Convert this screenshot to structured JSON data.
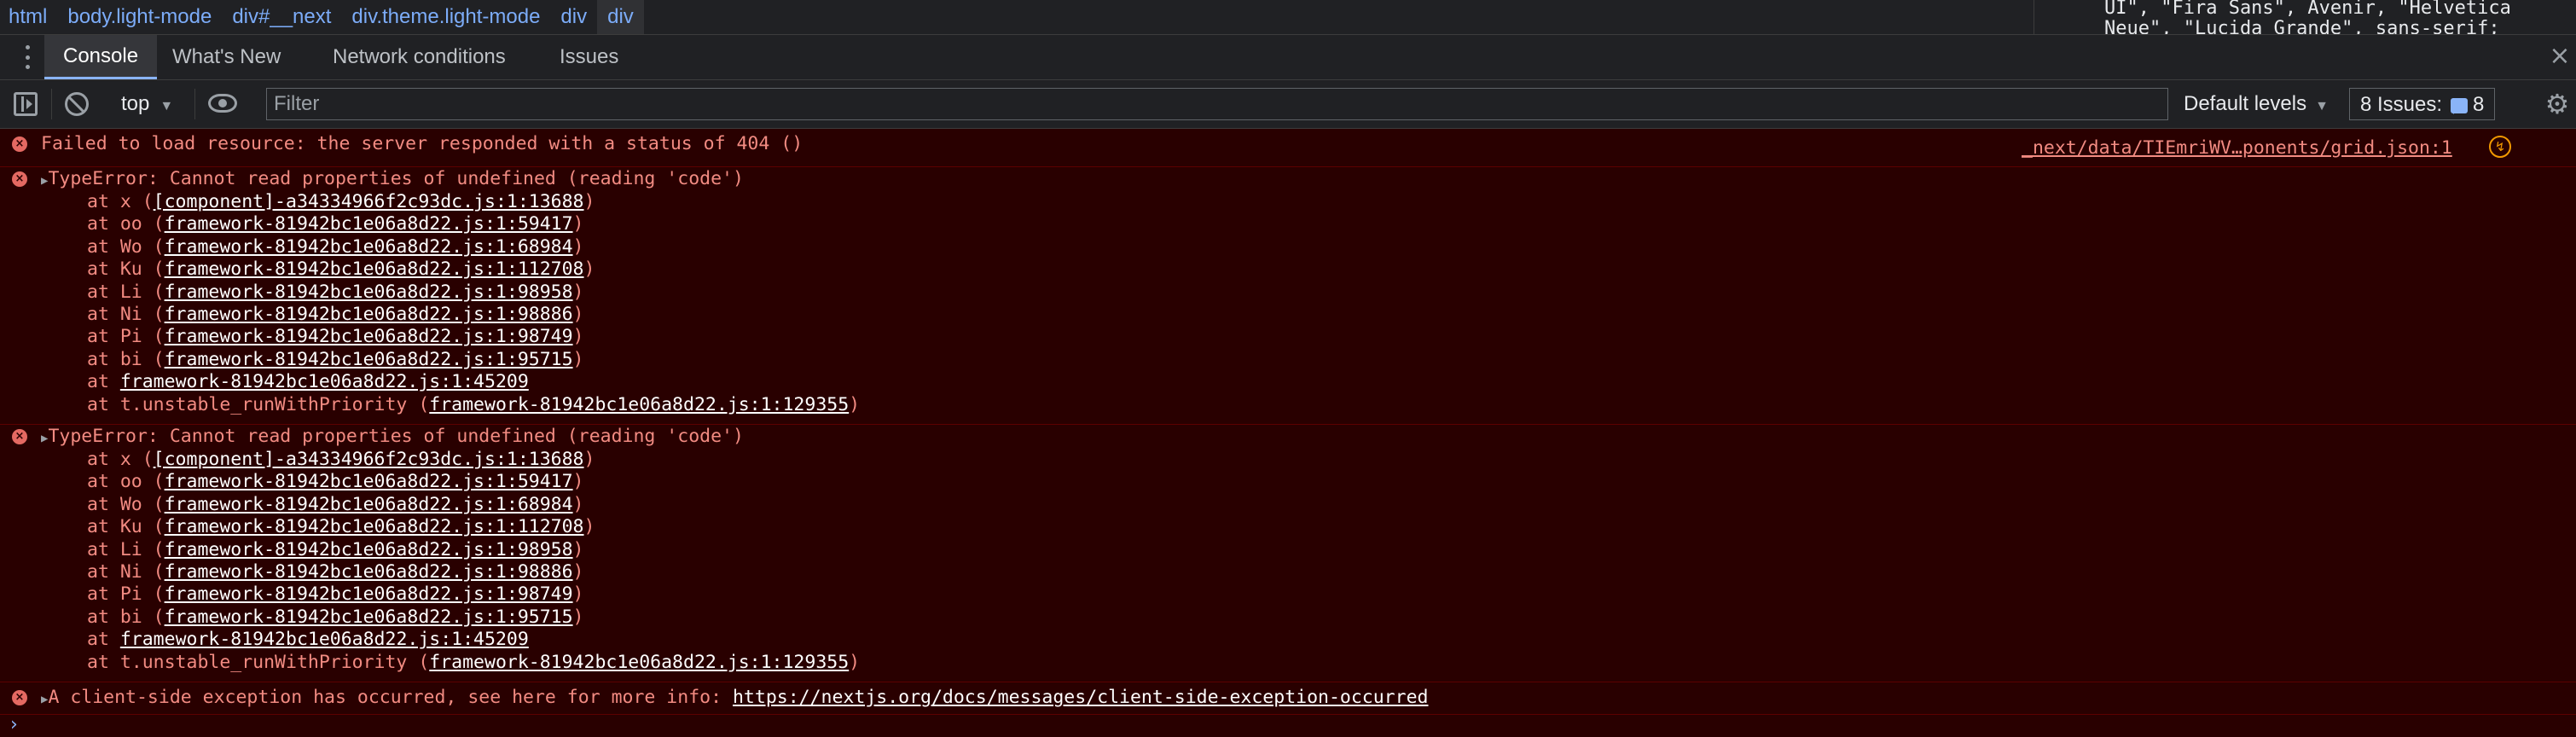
{
  "breadcrumbs": [
    "html",
    "body.light-mode",
    "div#__next",
    "div.theme.light-mode",
    "div",
    "div"
  ],
  "styles_peek": {
    "line1": "UI\", \"Fira Sans\", Avenir, \"Helvetica",
    "line2": "Neue\", \"Lucida Grande\", sans-serif;"
  },
  "drawer": {
    "tabs": [
      "Console",
      "What's New",
      "Network conditions",
      "Issues"
    ],
    "active_tab": "Console",
    "close_glyph": "×"
  },
  "toolbar": {
    "context": "top",
    "filter_placeholder": "Filter",
    "levels": "Default levels",
    "issues_label": "8 Issues:",
    "issues_count": "8"
  },
  "messages": [
    {
      "type": "error",
      "text": "Failed to load resource: the server responded with a status of 404 ()",
      "source": "_next/data/TIEmriWV…ponents/grid.json:1"
    },
    {
      "type": "error",
      "text": "TypeError: Cannot read properties of undefined (reading 'code')",
      "stack": [
        {
          "fn": "x",
          "loc": "[component]-a34334966f2c93dc.js:1:13688"
        },
        {
          "fn": "oo",
          "loc": "framework-81942bc1e06a8d22.js:1:59417"
        },
        {
          "fn": "Wo",
          "loc": "framework-81942bc1e06a8d22.js:1:68984"
        },
        {
          "fn": "Ku",
          "loc": "framework-81942bc1e06a8d22.js:1:112708"
        },
        {
          "fn": "Li",
          "loc": "framework-81942bc1e06a8d22.js:1:98958"
        },
        {
          "fn": "Ni",
          "loc": "framework-81942bc1e06a8d22.js:1:98886"
        },
        {
          "fn": "Pi",
          "loc": "framework-81942bc1e06a8d22.js:1:98749"
        },
        {
          "fn": "bi",
          "loc": "framework-81942bc1e06a8d22.js:1:95715"
        },
        {
          "fn": "",
          "loc": "framework-81942bc1e06a8d22.js:1:45209"
        },
        {
          "fn": "t.unstable_runWithPriority",
          "loc": "framework-81942bc1e06a8d22.js:1:129355"
        }
      ]
    },
    {
      "type": "error",
      "text": "TypeError: Cannot read properties of undefined (reading 'code')",
      "stack": [
        {
          "fn": "x",
          "loc": "[component]-a34334966f2c93dc.js:1:13688"
        },
        {
          "fn": "oo",
          "loc": "framework-81942bc1e06a8d22.js:1:59417"
        },
        {
          "fn": "Wo",
          "loc": "framework-81942bc1e06a8d22.js:1:68984"
        },
        {
          "fn": "Ku",
          "loc": "framework-81942bc1e06a8d22.js:1:112708"
        },
        {
          "fn": "Li",
          "loc": "framework-81942bc1e06a8d22.js:1:98958"
        },
        {
          "fn": "Ni",
          "loc": "framework-81942bc1e06a8d22.js:1:98886"
        },
        {
          "fn": "Pi",
          "loc": "framework-81942bc1e06a8d22.js:1:98749"
        },
        {
          "fn": "bi",
          "loc": "framework-81942bc1e06a8d22.js:1:95715"
        },
        {
          "fn": "",
          "loc": "framework-81942bc1e06a8d22.js:1:45209"
        },
        {
          "fn": "t.unstable_runWithPriority",
          "loc": "framework-81942bc1e06a8d22.js:1:129355"
        }
      ]
    },
    {
      "type": "error",
      "text": "A client-side exception has occurred, see here for more info: ",
      "link": "https://nextjs.org/docs/messages/client-side-exception-occurred"
    }
  ],
  "prompt_glyph": "›",
  "colors": {
    "console_bg": "#290000",
    "error_text": "#f28b82",
    "link_text": "#ffffff",
    "accent": "#8ab4f8",
    "panel_bg": "#202124"
  },
  "icons": [
    "drawer-menu-icon",
    "sidebar-toggle-icon",
    "clear-console-icon",
    "eye-icon",
    "issues-icon",
    "settings-gear-icon",
    "close-icon",
    "error-icon",
    "insights-icon"
  ]
}
